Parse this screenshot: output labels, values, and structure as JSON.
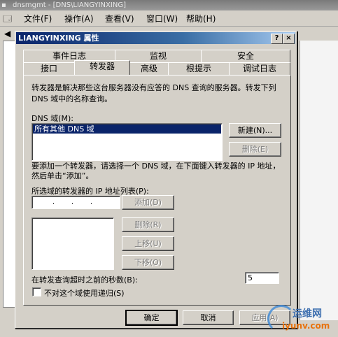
{
  "mmc": {
    "title": "dnsmgmt - [DNS\\LIANGYINXING]",
    "menu": [
      "文件(F)",
      "操作(A)",
      "查看(V)",
      "窗口(W)",
      "帮助(H)"
    ]
  },
  "dialog": {
    "title": "LIANGYINXING 属性",
    "help_label": "?",
    "close_label": "×",
    "tabs_back": [
      "事件日志",
      "监视",
      "安全"
    ],
    "tabs_front": [
      "接口",
      "转发器",
      "高级",
      "根提示",
      "调试日志"
    ],
    "selected_tab": "转发器",
    "description": "转发器是解决那些这台服务器没有应答的 DNS 查询的服务器。转发下列 DNS 域中的名称查询。",
    "dns_domain_label": "DNS 域(M):",
    "dns_domains": [
      "所有其他 DNS 域"
    ],
    "new_button": "新建(N)...",
    "delete_domain_button": "删除(E)",
    "instruction": "要添加一个转发器，请选择一个 DNS 域，在下面键入转发器的 IP 地址，然后单击“添加”。",
    "ip_list_label": "所选域的转发器的 IP 地址列表(P):",
    "ip_input_value": ". . .",
    "add_button": "添加(D)",
    "remove_button": "删除(R)",
    "move_up_button": "上移(U)",
    "move_down_button": "下移(O)",
    "timeout_label": "在转发查询超时之前的秒数(B):",
    "timeout_value": "5",
    "no_recursion_label": "不对这个域使用递归(S)",
    "no_recursion_checked": false,
    "ok_button": "确定",
    "cancel_button": "取消",
    "apply_button": "应用(A)"
  },
  "watermark": {
    "text": "运维网",
    "url_text": "iyunv.com"
  },
  "colors": {
    "titlebar": "#0a246a",
    "face": "#d4d0c8",
    "selection": "#0a246a"
  }
}
